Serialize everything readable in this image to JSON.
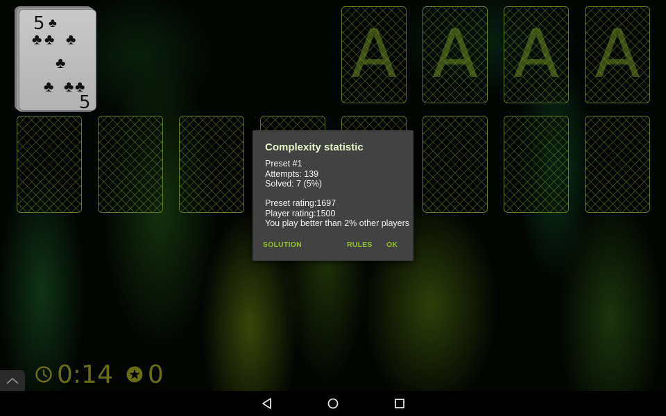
{
  "foundations": [
    {
      "letter": "A"
    },
    {
      "letter": "A"
    },
    {
      "letter": "A"
    },
    {
      "letter": "A"
    }
  ],
  "stock_card": {
    "rank": "5",
    "suit": "♣"
  },
  "status": {
    "time": "0:14",
    "score": "0",
    "time_icon": "clock-icon",
    "score_icon": "star-icon"
  },
  "dialog": {
    "title": "Complexity statistic",
    "preset": "Preset #1",
    "attempts": "Attempts: 139",
    "solved": "Solved: 7 (5%)",
    "preset_rating": "Preset rating:1697",
    "player_rating": "Player rating:1500",
    "comparison": "You play better than 2% other players",
    "buttons": {
      "solution": "SOLUTION",
      "rules": "RULES",
      "ok": "OK"
    }
  },
  "colors": {
    "accent": "#8bc420",
    "slot_outline": "#5d7a1c",
    "status_text": "#6b6d15",
    "dialog_bg": "#424242"
  },
  "navigation": {
    "back_icon": "back-triangle-icon",
    "home_icon": "home-circle-icon",
    "recents_icon": "recents-square-icon"
  }
}
